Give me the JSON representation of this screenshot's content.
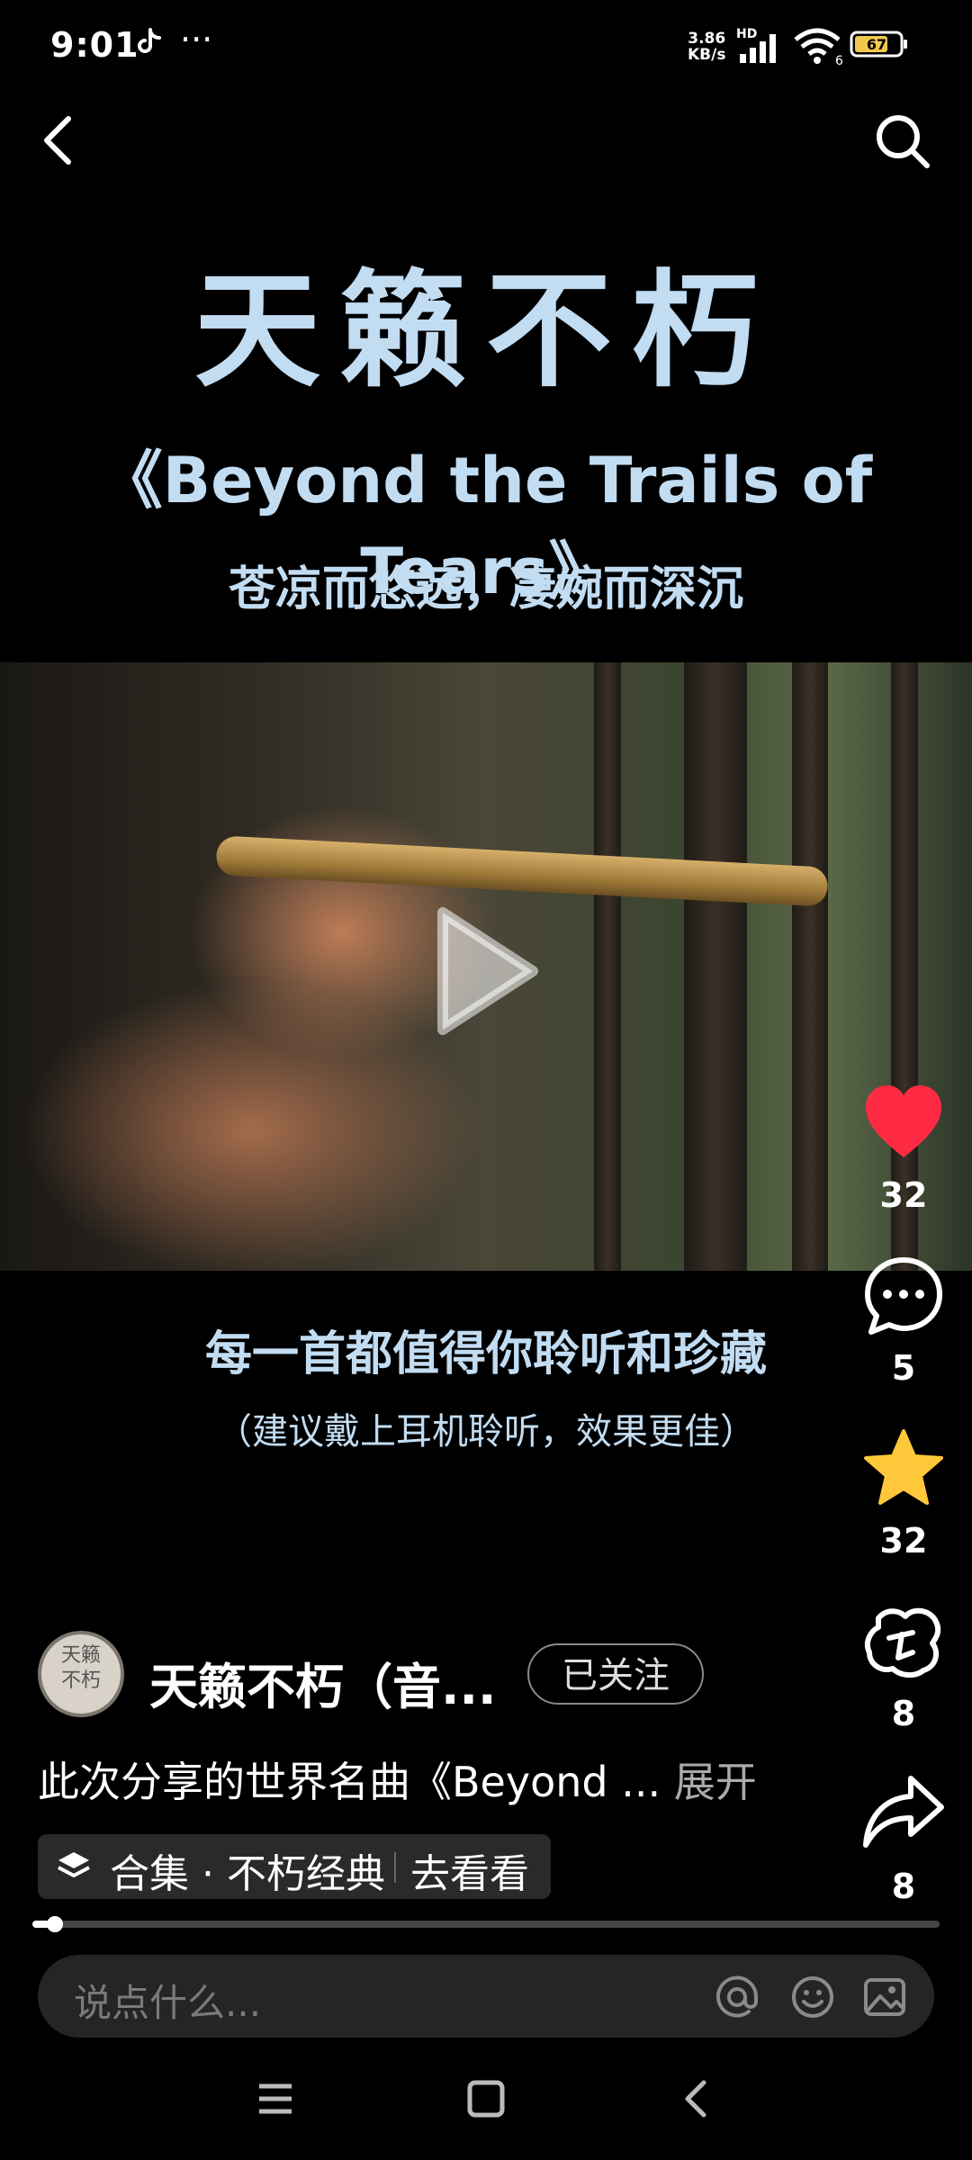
{
  "status_bar": {
    "time": "9:01",
    "more": "···",
    "net_speed_value": "3.86",
    "net_speed_unit": "KB/s",
    "hd": "HD",
    "wifi_label": "6",
    "battery": "67"
  },
  "titles": {
    "main": "天籁不朽",
    "english": "《Beyond the Trails of Tears》",
    "subtitle": "苍凉而悠远，凄婉而深沉"
  },
  "captions": {
    "line1": "每一首都值得你聆听和珍藏",
    "line2": "（建议戴上耳机聆听，效果更佳）"
  },
  "actions": {
    "like_count": "32",
    "comment_count": "5",
    "favorite_count": "32",
    "gift_count": "8",
    "share_count": "8"
  },
  "author": {
    "avatar_text_1": "天籁",
    "avatar_text_2": "不朽",
    "name": "天籁不朽（音...",
    "follow_label": "已关注"
  },
  "description": {
    "text": "此次分享的世界名曲《Beyond ...",
    "more_label": "展开"
  },
  "collection": {
    "label": "合集 · 不朽经典",
    "action": "去看看"
  },
  "progress": {
    "fraction": 0.02
  },
  "comment_bar": {
    "placeholder": "说点什么..."
  },
  "colors": {
    "title_blue": "#c2dcf2",
    "like_red": "#ff2b45",
    "star_yellow": "#ffc83a"
  }
}
